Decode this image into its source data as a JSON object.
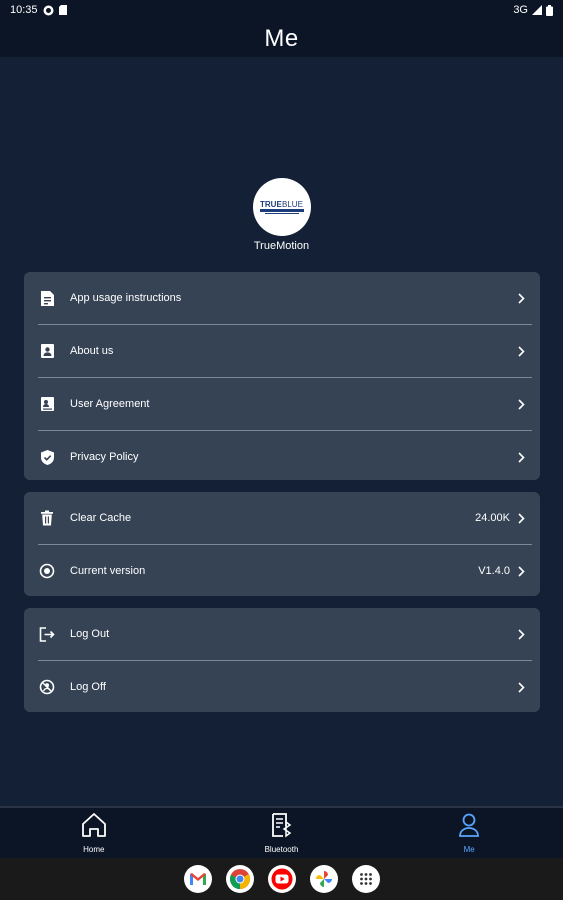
{
  "status_bar": {
    "time": "10:35",
    "network": "3G"
  },
  "header": {
    "title": "Me"
  },
  "profile": {
    "logo_text": "TRUEBLUE",
    "name": "TrueMotion"
  },
  "groups": [
    {
      "items": [
        {
          "label": "App usage instructions",
          "icon": "document-icon"
        },
        {
          "label": "About us",
          "icon": "contact-card-icon"
        },
        {
          "label": "User Agreement",
          "icon": "agreement-icon"
        },
        {
          "label": "Privacy Policy",
          "icon": "shield-check-icon"
        }
      ]
    },
    {
      "items": [
        {
          "label": "Clear Cache",
          "value": "24.00K",
          "icon": "trash-icon"
        },
        {
          "label": "Current version",
          "value": "V1.4.0",
          "icon": "version-icon"
        }
      ]
    },
    {
      "items": [
        {
          "label": "Log Out",
          "icon": "logout-icon"
        },
        {
          "label": "Log Off",
          "icon": "account-cancel-icon"
        }
      ]
    }
  ],
  "bottom_nav": [
    {
      "label": "Home",
      "icon": "home-icon",
      "active": false
    },
    {
      "label": "Bluetooth",
      "icon": "bluetooth-doc-icon",
      "active": false
    },
    {
      "label": "Me",
      "icon": "person-icon",
      "active": true
    }
  ],
  "dock": [
    "gmail-icon",
    "chrome-icon",
    "youtube-icon",
    "photos-icon",
    "app-drawer-icon"
  ],
  "colors": {
    "background": "#142036",
    "card": "#364355",
    "bar": "#0b1526",
    "accent": "#5aa6ff"
  }
}
